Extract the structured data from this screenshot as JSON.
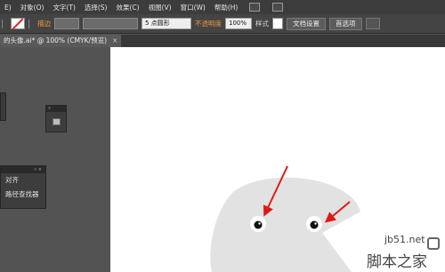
{
  "menu": {
    "items": [
      "E)",
      "对象(O)",
      "文字(T)",
      "选择(S)",
      "效果(C)",
      "视图(V)",
      "窗口(W)",
      "帮助(H)"
    ]
  },
  "control_bar": {
    "stroke_label": "描边",
    "brush_value": "5 点圆形",
    "opacity_label": "不透明度",
    "opacity_value": "100%",
    "style_label": "样式",
    "doc_setup_button": "文档设置",
    "preferences_button": "首选项"
  },
  "document_tab": {
    "title": "的头像.ai* @ 100% (CMYK/预览)",
    "close": "×"
  },
  "panels": {
    "align_label": "对齐",
    "pathfinder_label": "路径查找器"
  },
  "watermark": {
    "url": "jb51.net",
    "site_name": "脚本之家"
  },
  "colors": {
    "menubar": "#3c3c3c",
    "control_bar": "#444444",
    "workspace": "#535353",
    "artboard": "#ffffff",
    "blob_fill": "#e2e2e2",
    "arrow": "#e01818",
    "accent_label": "#e89a3c"
  }
}
